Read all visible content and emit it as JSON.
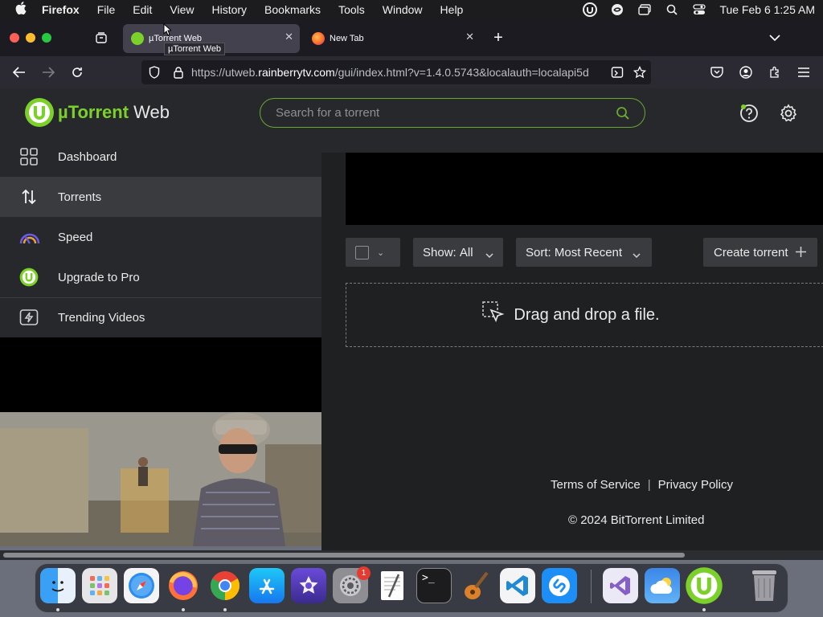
{
  "menubar": {
    "app_name": "Firefox",
    "items": [
      "File",
      "Edit",
      "View",
      "History",
      "Bookmarks",
      "Tools",
      "Window",
      "Help"
    ],
    "clock": "Tue Feb 6  1:25 AM"
  },
  "browser": {
    "tabs": [
      {
        "title": "µTorrent Web",
        "active": true
      },
      {
        "title": "New Tab",
        "active": false
      }
    ],
    "tooltip": "µTorrent Web",
    "url_prefix": "https://utweb.",
    "url_host": "rainberrytv.com",
    "url_rest": "/gui/index.html?v=1.4.0.5743&localauth=localapi5d"
  },
  "app": {
    "logo_brand": "µTorrent",
    "logo_suffix": "Web",
    "search_placeholder": "Search for a torrent",
    "sidebar": [
      {
        "label": "Dashboard",
        "icon": "dashboard-icon",
        "active": false
      },
      {
        "label": "Torrents",
        "icon": "transfer-arrows-icon",
        "active": true
      },
      {
        "label": "Speed",
        "icon": "speedometer-icon",
        "active": false
      },
      {
        "label": "Upgrade to Pro",
        "icon": "utorrent-logo-icon",
        "active": false
      },
      {
        "label": "Trending Videos",
        "icon": "lightning-video-icon",
        "active": false
      }
    ],
    "toolbar": {
      "show_label": "Show:",
      "show_value": "All",
      "sort_label": "Sort:",
      "sort_value": "Most Recent",
      "create_label": "Create torrent"
    },
    "dropzone_text": "Drag and drop a file.",
    "footer": {
      "terms": "Terms of Service",
      "privacy": "Privacy Policy",
      "copyright": "© 2024 BitTorrent Limited"
    }
  },
  "dock": {
    "items": [
      "Finder",
      "Launchpad",
      "Safari",
      "Firefox",
      "Chrome",
      "App Store",
      "iMovie",
      "System Settings",
      "TextEdit",
      "Terminal",
      "GarageBand",
      "VS Code",
      "Shazam",
      "Visual Studio",
      "Weather",
      "µTorrent",
      "Trash"
    ],
    "settings_badge": "1"
  },
  "colors": {
    "accent_green": "#7bd12a",
    "panel_bg": "#27282b",
    "main_bg": "#1f2022"
  }
}
